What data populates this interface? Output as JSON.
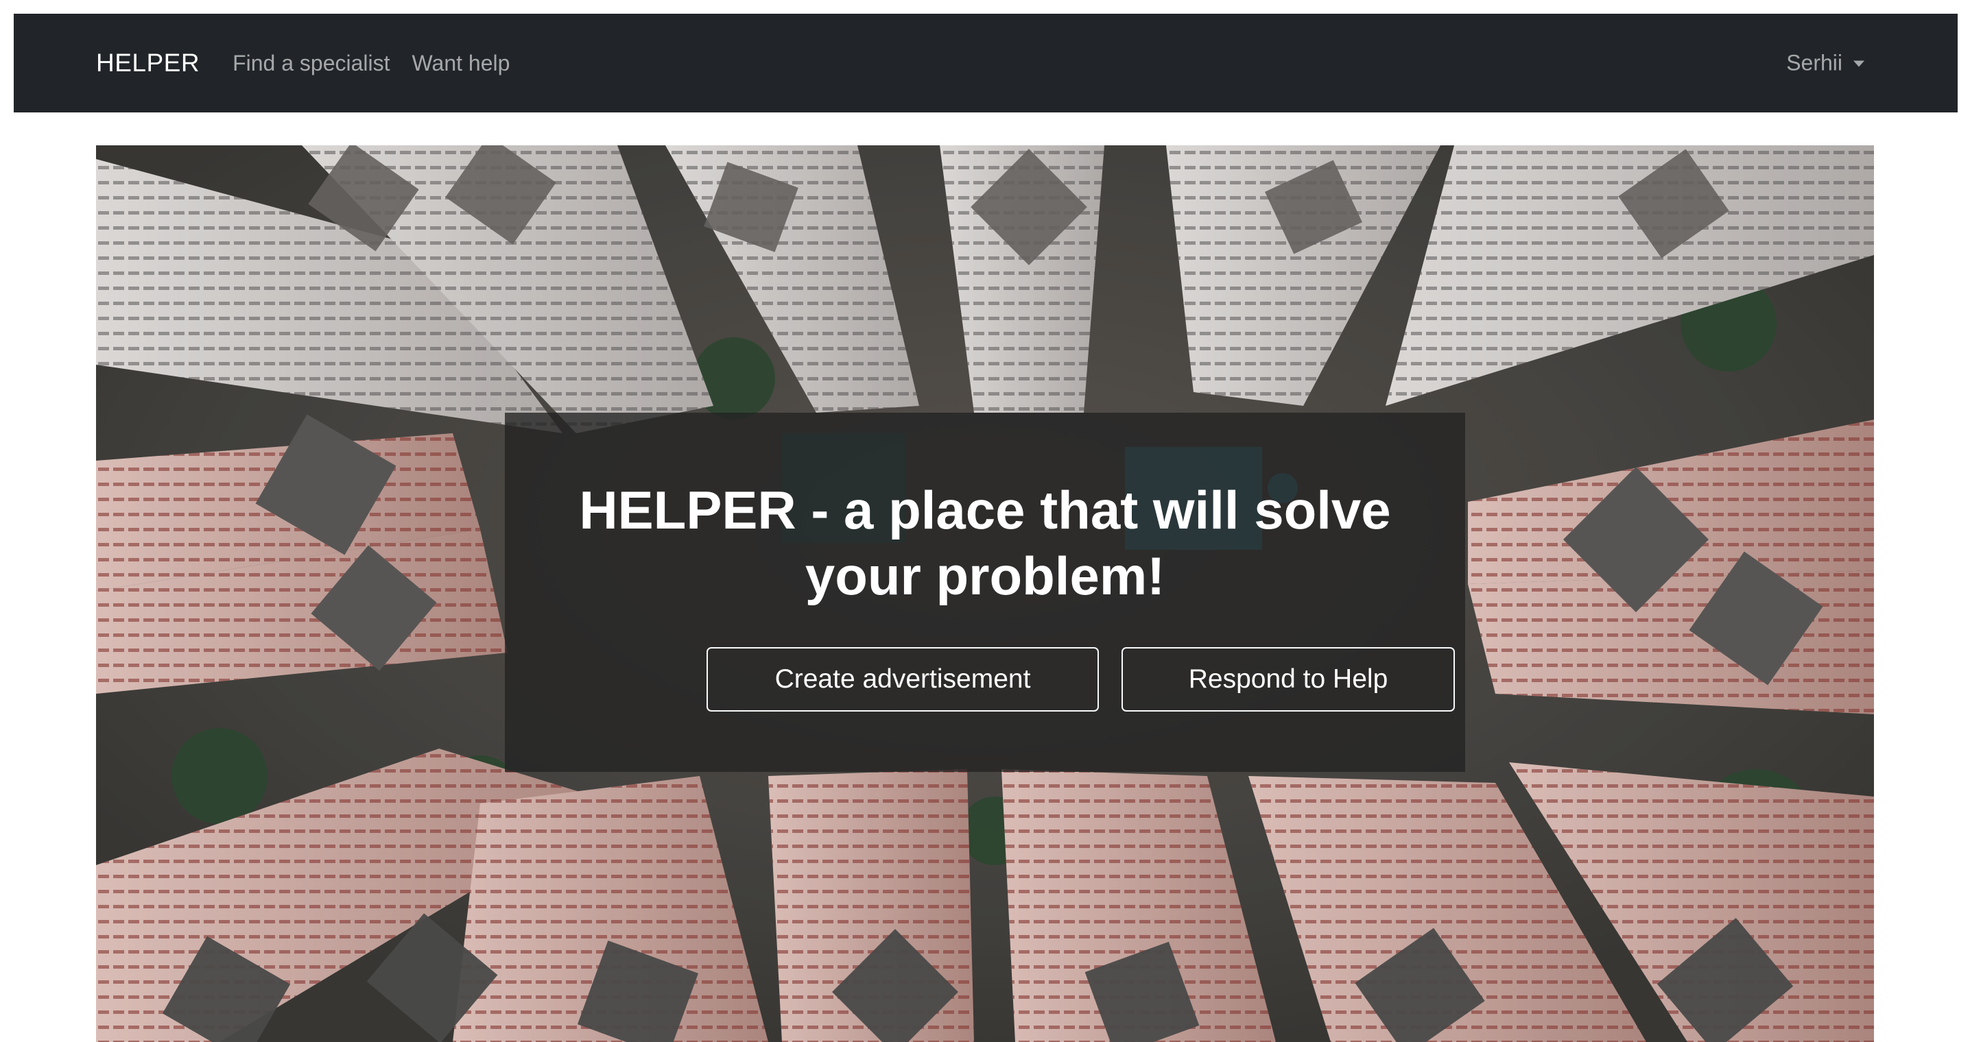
{
  "navbar": {
    "brand": "HELPER",
    "links": [
      "Find a specialist",
      "Want help"
    ],
    "user": "Serhii"
  },
  "hero": {
    "headline": "HELPER - a place that will solve your problem!",
    "buttons": {
      "create": "Create advertisement",
      "respond": "Respond to Help"
    },
    "background": "aerial-view-of-high-rise-buildings"
  },
  "colors": {
    "navbar_bg": "#212529",
    "overlay_bg": "rgba(35,35,35,0.78)",
    "button_border": "#f8f9fa"
  }
}
